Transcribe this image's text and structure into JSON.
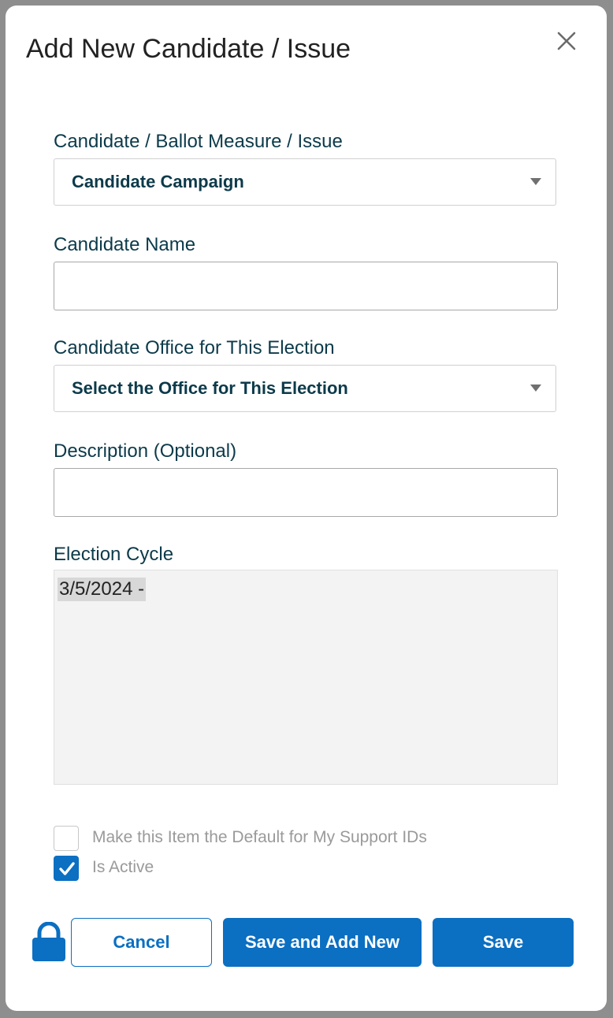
{
  "dialog": {
    "title": "Add New Candidate / Issue",
    "close_icon": "close-icon"
  },
  "fields": {
    "type": {
      "label": "Candidate / Ballot Measure / Issue",
      "selected": "Candidate Campaign"
    },
    "name": {
      "label": "Candidate Name",
      "value": ""
    },
    "office": {
      "label": "Candidate Office for This Election",
      "selected": "Select the Office for This Election"
    },
    "description": {
      "label": "Description (Optional)",
      "value": ""
    },
    "election_cycle": {
      "label": "Election Cycle",
      "options": [
        "3/5/2024 -"
      ]
    }
  },
  "checkboxes": {
    "default_item": {
      "label": "Make this Item the Default for My Support IDs",
      "checked": false
    },
    "is_active": {
      "label": "Is Active",
      "checked": true
    }
  },
  "footer": {
    "lock_icon": "lock-icon",
    "cancel_label": "Cancel",
    "save_new_label": "Save and Add New",
    "save_label": "Save"
  },
  "colors": {
    "primary": "#0b6fc2",
    "label_text": "#0c3a4a",
    "backdrop": "#8e8e8e"
  }
}
